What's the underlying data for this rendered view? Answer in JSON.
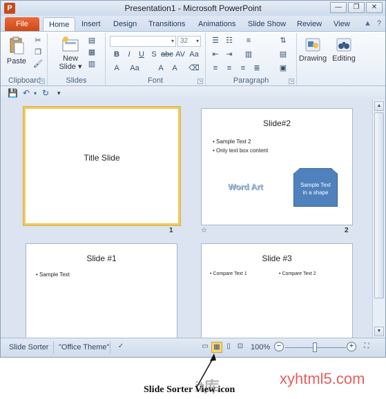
{
  "window": {
    "title": "Presentation1 - Microsoft PowerPoint",
    "app_icon": "P",
    "buttons": [
      "—",
      "❐",
      "✕"
    ]
  },
  "tabs": {
    "file": "File",
    "items": [
      "Home",
      "Insert",
      "Design",
      "Transitions",
      "Animations",
      "Slide Show",
      "Review",
      "View"
    ],
    "active": "Home",
    "right_icons": [
      "▲",
      "?"
    ]
  },
  "ribbon": {
    "clipboard": {
      "label": "Clipboard",
      "paste": "Paste"
    },
    "slides": {
      "label": "Slides",
      "new_slide": "New",
      "new_slide_2": "Slide ▾"
    },
    "font": {
      "label": "Font",
      "size": "32"
    },
    "paragraph": {
      "label": "Paragraph"
    },
    "drawing": {
      "label": "Drawing"
    },
    "editing": {
      "label": "Editing"
    }
  },
  "slides": [
    {
      "title": "Title Slide",
      "number": "1",
      "selected": true
    },
    {
      "title": "Slide#2",
      "number": "2",
      "bullets": [
        "Sample Text 2",
        "Only text box content"
      ],
      "wordart": "Word Art",
      "shape_text_1": "Sample Text",
      "shape_text_2": "in a shape"
    },
    {
      "title": "Slide #1",
      "bullets": [
        "Sample Text"
      ]
    },
    {
      "title": "Slide #3",
      "bullets": [
        "Compare Text 1",
        "Compare Text 2"
      ]
    }
  ],
  "statusbar": {
    "view_name": "Slide Sorter",
    "theme": "\"Office Theme\"",
    "zoom": "100%"
  },
  "annotation": {
    "caption": "Slide Sorter View icon",
    "watermark_left": "it库",
    "watermark_right": "xyhtml5.com"
  }
}
